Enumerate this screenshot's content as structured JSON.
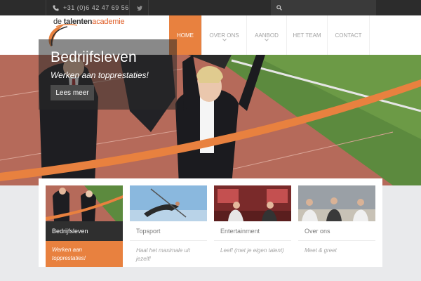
{
  "topbar": {
    "phone_icon": "phone-icon",
    "phone": "+31 (0)6 42 47 69 56",
    "twitter_icon": "twitter-icon",
    "search_icon": "search-icon"
  },
  "header": {
    "logo_prefix": "de ",
    "logo_bold": "talenten",
    "logo_accent": "academie",
    "nav": [
      {
        "label": "HOME",
        "active": true
      },
      {
        "label": "OVER ONS",
        "dropdown": true
      },
      {
        "label": "AANBOD",
        "dropdown": true
      },
      {
        "label": "HET TEAM"
      },
      {
        "label": "CONTACT"
      }
    ]
  },
  "hero": {
    "title": "Bedrijfsleven",
    "subtitle": "Werken aan topprestaties!",
    "button": "Lees meer"
  },
  "cards": [
    {
      "title": "Bedrijfsleven",
      "desc": "Werken aan topprestaties!"
    },
    {
      "title": "Topsport",
      "desc": "Haal het maximale uit jezelf!"
    },
    {
      "title": "Entertainment",
      "desc": "Leef! (met je eigen talent)"
    },
    {
      "title": "Over ons",
      "desc": "Meet & greet"
    }
  ],
  "colors": {
    "accent": "#e8813f",
    "dark": "#2c2c2c"
  }
}
